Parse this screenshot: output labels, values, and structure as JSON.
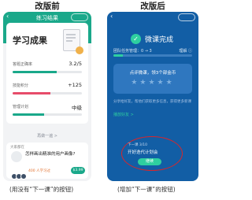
{
  "labels": {
    "before": "改版前",
    "after": "改版后",
    "before_caption": "(用没有“下一课”的按钮)",
    "after_caption": "(增加“下一课”的按钮)"
  },
  "left_phone": {
    "nav_title": "练习结果",
    "card_title": "学习成果",
    "rows": [
      {
        "label": "答题正确率",
        "value": "3.2/5",
        "fill": 0.64,
        "color": "#1aa88a"
      },
      {
        "label": "技能积分",
        "value": "+125",
        "fill": 0.55,
        "color": "#e74c6a"
      },
      {
        "label": "管理计划",
        "value": "中级",
        "fill": 0.45,
        "color": "#1aa88a"
      }
    ],
    "see_more": "再做一遍 >",
    "recommend_label": "大家都在",
    "course_title": "怎样画出精准的用户画像?",
    "learners": "400 人学习过",
    "price": "$3.99"
  },
  "right_phone": {
    "status": "微课完成",
    "team_label": "团队任务管理：0 → 3",
    "team_right": "理解 ⓘ",
    "team_progress": 0.12,
    "rate_text": "点评微课，领3个部金币",
    "stars": "★★★★★",
    "share_text": "分享给好友，帮他们获取更多信息，获得更多新课",
    "share_link": "播放好友 >",
    "next_label": "下一课 3/10",
    "next_title": "开好迭代计划会",
    "next_button": "继续"
  },
  "colors": {
    "teal": "#1aa88a",
    "blue": "#125ea5",
    "highlight": "#d9262b"
  }
}
